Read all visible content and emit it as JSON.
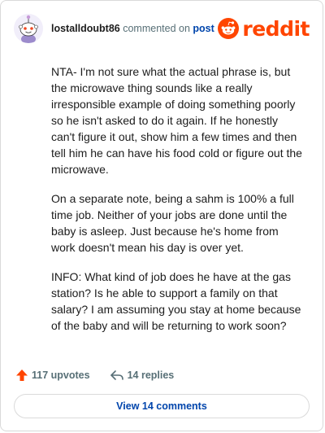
{
  "header": {
    "username": "lostalldoubt86",
    "commented_text": "commented on",
    "post_link": "post",
    "logo_text": "reddit"
  },
  "comment": {
    "paragraphs": [
      "NTA- I'm not sure what the actual phrase is, but the microwave thing sounds like a really irresponsible example of doing something poorly so he isn't asked to do it again. If he honestly can't figure it out, show him a few times and then tell him he can have his food cold or figure out the microwave.",
      "On a separate note, being a sahm is 100% a full time job. Neither of your jobs are done until the baby is asleep. Just because he's home from work doesn't mean his day is over yet.",
      "INFO: What kind of job does he have at the gas station? Is he able to support a family on that salary? I am assuming you stay at home because of the baby and will be returning to work soon?"
    ]
  },
  "actions": {
    "upvotes_label": "117 upvotes",
    "replies_label": "14 replies",
    "upvote_icon": "arrow-up-icon",
    "reply_icon": "reply-arrow-icon"
  },
  "footer": {
    "view_comments_label": "View 14 comments"
  },
  "colors": {
    "brand": "#ff4500",
    "link": "#0045ac",
    "muted": "#576f76"
  }
}
